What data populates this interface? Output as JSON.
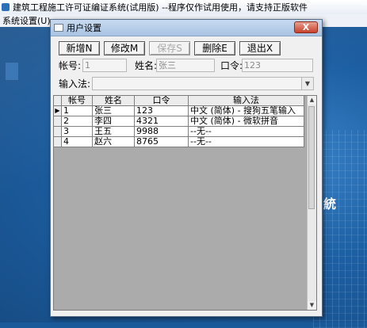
{
  "app": {
    "title": "建筑工程施工许可证编证系统(试用版)    --程序仅作试用使用，请支持正版软件",
    "menu": [
      "系统设置(U)"
    ],
    "background_text": "統"
  },
  "dialog": {
    "title": "用户设置",
    "close_symbol": "X"
  },
  "toolbar": {
    "new_label": "新增N",
    "edit_label": "修改M",
    "save_label": "保存S",
    "delete_label": "删除E",
    "exit_label": "退出X"
  },
  "form": {
    "account_label": "帐号:",
    "account_value": "1",
    "name_label": "姓名:",
    "name_value": "张三",
    "password_label": "口令:",
    "password_value": "123",
    "ime_label": "输入法:",
    "ime_value": ""
  },
  "grid": {
    "columns": [
      "帐号",
      "姓名",
      "口令",
      "输入法"
    ],
    "current_row_marker": "▶",
    "rows": [
      [
        "1",
        "张三",
        "123",
        "中文 (简体) - 搜狗五笔输入"
      ],
      [
        "2",
        "李四",
        "4321",
        "中文 (简体) - 微软拼音"
      ],
      [
        "3",
        "王五",
        "9988",
        "--无--"
      ],
      [
        "4",
        "赵六",
        "8765",
        "--无--"
      ]
    ]
  },
  "colors": {
    "desktop_blue": "#1b5a9a",
    "dialog_bg": "#f0f0f0",
    "close_red": "#c6412b",
    "grid_bg": "#ababab"
  }
}
